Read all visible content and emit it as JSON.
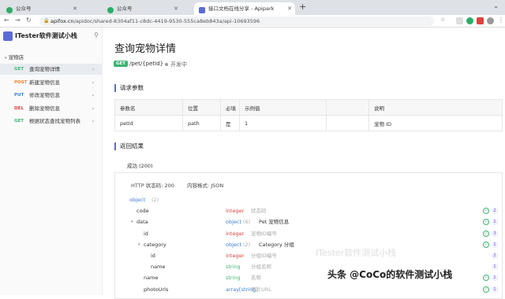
{
  "browser": {
    "tabs": [
      {
        "title": "公众号"
      },
      {
        "title": "公众号"
      },
      {
        "title": "接口文档在线分享 - Apipark"
      }
    ],
    "url_prefix": "apifox.cn",
    "url_rest": "/apidoc/shared-8304af11-c8dc-4419-9530-555ca8eb843a/api-10693596"
  },
  "sidebar": {
    "project": "ITester软件测试小栈",
    "folder": "宠物店",
    "items": [
      {
        "method": "GET",
        "color": "#3cb371",
        "label": "查询宠物详情",
        "selected": true
      },
      {
        "method": "POST",
        "color": "#ff7f27",
        "label": "新建宠物信息",
        "selected": false
      },
      {
        "method": "PUT",
        "color": "#3b7dd8",
        "label": "修改宠物信息",
        "selected": false
      },
      {
        "method": "DEL",
        "color": "#e0413b",
        "label": "删除宠物信息",
        "selected": false
      },
      {
        "method": "GET",
        "color": "#3cb371",
        "label": "根据状态查找宠物列表",
        "selected": false
      }
    ]
  },
  "main": {
    "title": "查询宠物详情",
    "method": "GET",
    "path": "/pet/{petId}",
    "status": "开发中",
    "req_title": "请求参数",
    "params_headers": [
      "参数名",
      "位置",
      "必填",
      "示例值",
      "",
      "说明"
    ],
    "params": [
      [
        "petId",
        "path",
        "是",
        "1",
        "",
        "宠物 ID"
      ]
    ],
    "resp_title": "返回结果",
    "resp_tab": "成功 (200)",
    "http_status": "HTTP 状态码: 200",
    "content_type": "内容格式: JSON",
    "fields": [
      {
        "name": "object",
        "count_label": "(2)",
        "type": "",
        "desc": "",
        "indent": 0,
        "badge": "",
        "check": false,
        "typecolor": "#3b7dd8"
      },
      {
        "name": "code",
        "count_label": "",
        "type": "integer",
        "desc": "状态码",
        "indent": 1,
        "badge": "2",
        "check": true,
        "typecolor": "#e0413b"
      },
      {
        "name": "data",
        "count_label": "",
        "type": "object",
        "desc": "Pet  宠物信息",
        "indent": 1,
        "badge": "1",
        "check": true,
        "typecolor": "#3b7dd8",
        "extra": "(6)"
      },
      {
        "name": "id",
        "count_label": "",
        "type": "integer",
        "desc": "宠物ID编号",
        "indent": 2,
        "badge": "3",
        "check": true,
        "typecolor": "#e0413b"
      },
      {
        "name": "category",
        "count_label": "",
        "type": "object",
        "desc": "Category  分组",
        "indent": 2,
        "badge": "1",
        "check": true,
        "typecolor": "#3b7dd8",
        "extra": "(2)"
      },
      {
        "name": "id",
        "count_label": "",
        "type": "integer",
        "desc": "分组ID编号",
        "indent": 3,
        "badge": "2",
        "check": false,
        "typecolor": "#e0413b"
      },
      {
        "name": "name",
        "count_label": "",
        "type": "string",
        "desc": "分组名称",
        "indent": 3,
        "badge": "1",
        "check": false,
        "typecolor": "#3cb371"
      },
      {
        "name": "name",
        "count_label": "",
        "type": "string",
        "desc": "名称",
        "indent": 2,
        "badge": "1",
        "check": true,
        "typecolor": "#3cb371"
      },
      {
        "name": "photoUrls",
        "count_label": "",
        "type": "array[string]",
        "desc": "照片URL",
        "indent": 2,
        "badge": "1",
        "check": true,
        "typecolor": "#3b7dd8"
      }
    ]
  },
  "watermark": "头条 @CoCo的软件测试小栈",
  "watermark_faint": "ITester软件测试小栈"
}
